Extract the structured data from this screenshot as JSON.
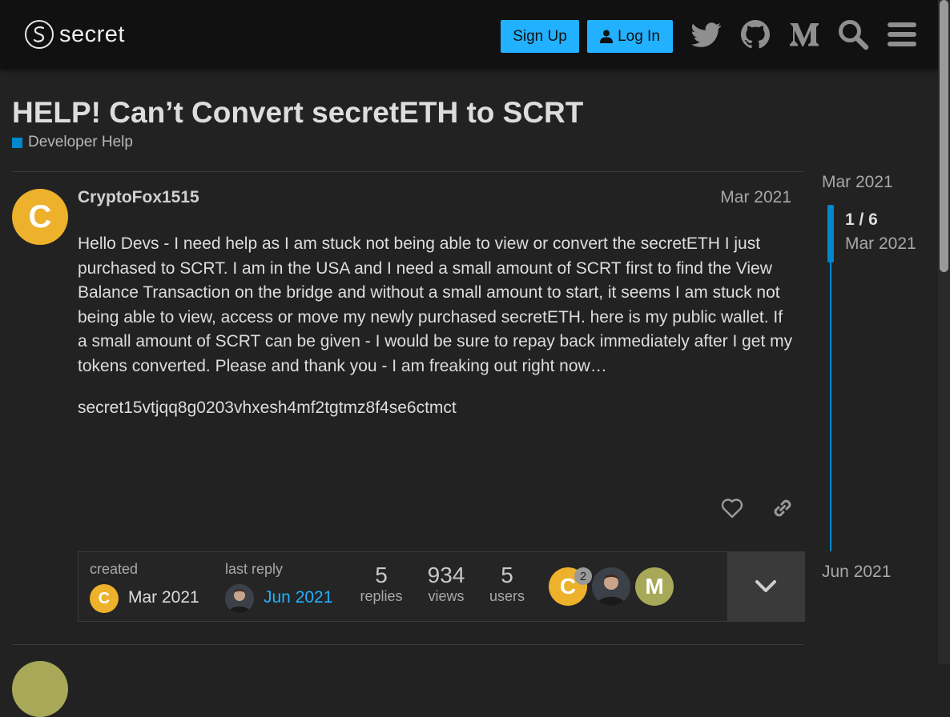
{
  "header": {
    "logo_text": "secret",
    "signup_label": "Sign Up",
    "login_label": "Log In",
    "icons": [
      "twitter-icon",
      "github-icon",
      "medium-icon",
      "search-icon",
      "hamburger-menu-icon"
    ]
  },
  "topic": {
    "title": "HELP! Can’t Convert secretETH to SCRT",
    "category": "Developer Help",
    "category_color": "#0088cc"
  },
  "post": {
    "avatar_letter": "C",
    "avatar_color": "#edb12c",
    "username": "CryptoFox1515",
    "date": "Mar 2021",
    "paragraphs": [
      "Hello Devs - I need help as I am stuck not being able to view or convert the secretETH I just purchased to SCRT. I am in the USA and I need a small amount of SCRT first to find the View Balance Transaction on the bridge and without a small amount to start, it seems I am stuck not being able to view, access or move my newly purchased secretETH. here is my public wallet. If a small amount of SCRT can be given - I would be sure to repay back immediately after I get my tokens converted. Please and thank you - I am freaking out right now…",
      "secret15vtjqq8g0203vhxesh4mf2tgtmz8f4se6ctmct"
    ]
  },
  "topic_map": {
    "created_label": "created",
    "created_date": "Mar 2021",
    "created_avatar_letter": "C",
    "last_reply_label": "last reply",
    "last_reply_date": "Jun 2021",
    "replies": "5",
    "replies_label": "replies",
    "views": "934",
    "views_label": "views",
    "users": "5",
    "users_label": "users",
    "participants": [
      {
        "letter": "C",
        "color": "#edb12c",
        "count": "2"
      },
      {
        "letter": "",
        "color": "#3b4049",
        "count": ""
      },
      {
        "letter": "M",
        "color": "#a8a859",
        "count": ""
      }
    ]
  },
  "timeline": {
    "start": "Mar 2021",
    "position": "1 / 6",
    "current_date": "Mar 2021",
    "end": "Jun 2021"
  },
  "accent": "#21b1ff"
}
